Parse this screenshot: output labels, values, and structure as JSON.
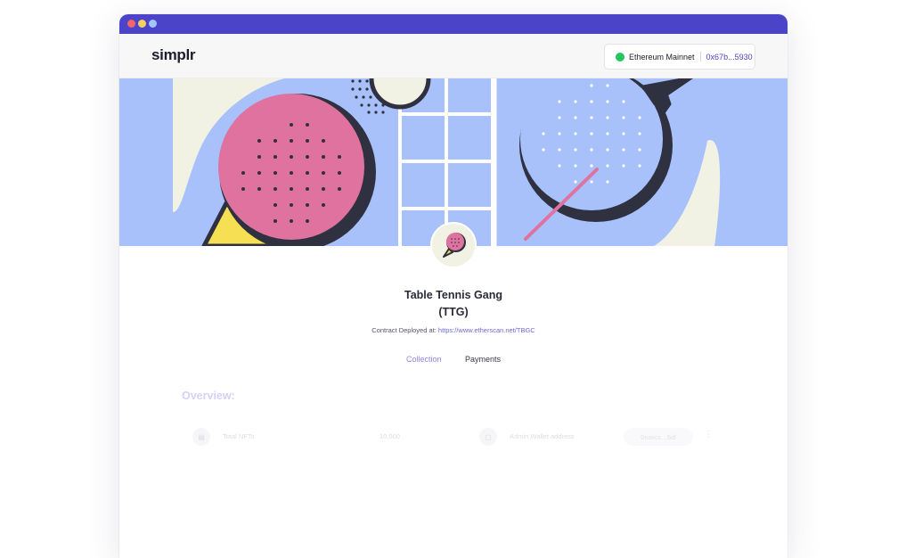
{
  "window": {
    "controls": [
      "close",
      "minimize",
      "maximize"
    ]
  },
  "appbar": {
    "logo": "simplr",
    "wallet": {
      "network": "Ethereum Mainnet",
      "network_status_color": "#22c55e",
      "address": "0x67b...5930"
    }
  },
  "collection": {
    "name": "Table Tennis Gang",
    "symbol": "(TTG)",
    "contract_prefix": "Contract Deployed at:",
    "contract_link": "https://www.etherscan.net/TBGC",
    "banner_icon": "ping-pong-paddles-illustration",
    "avatar_icon": "ping-pong-paddle-icon"
  },
  "tabs": [
    {
      "label": "Collection",
      "active": true
    },
    {
      "label": "Payments",
      "active": false
    }
  ],
  "overview": {
    "heading": "Overview:",
    "stats": [
      {
        "icon": "nft-icon",
        "label": "Total NFTs",
        "value": "10,000"
      },
      {
        "icon": "wallet-icon",
        "label": "Admin Wallet address",
        "value": "0xaxcc...5dl"
      }
    ]
  },
  "colors": {
    "accent": "#4b43c8",
    "banner_bg": "#a8c1fa",
    "paddle_pink": "#e0729f",
    "handle_yellow": "#f6df52",
    "cream": "#f1f2e4"
  }
}
